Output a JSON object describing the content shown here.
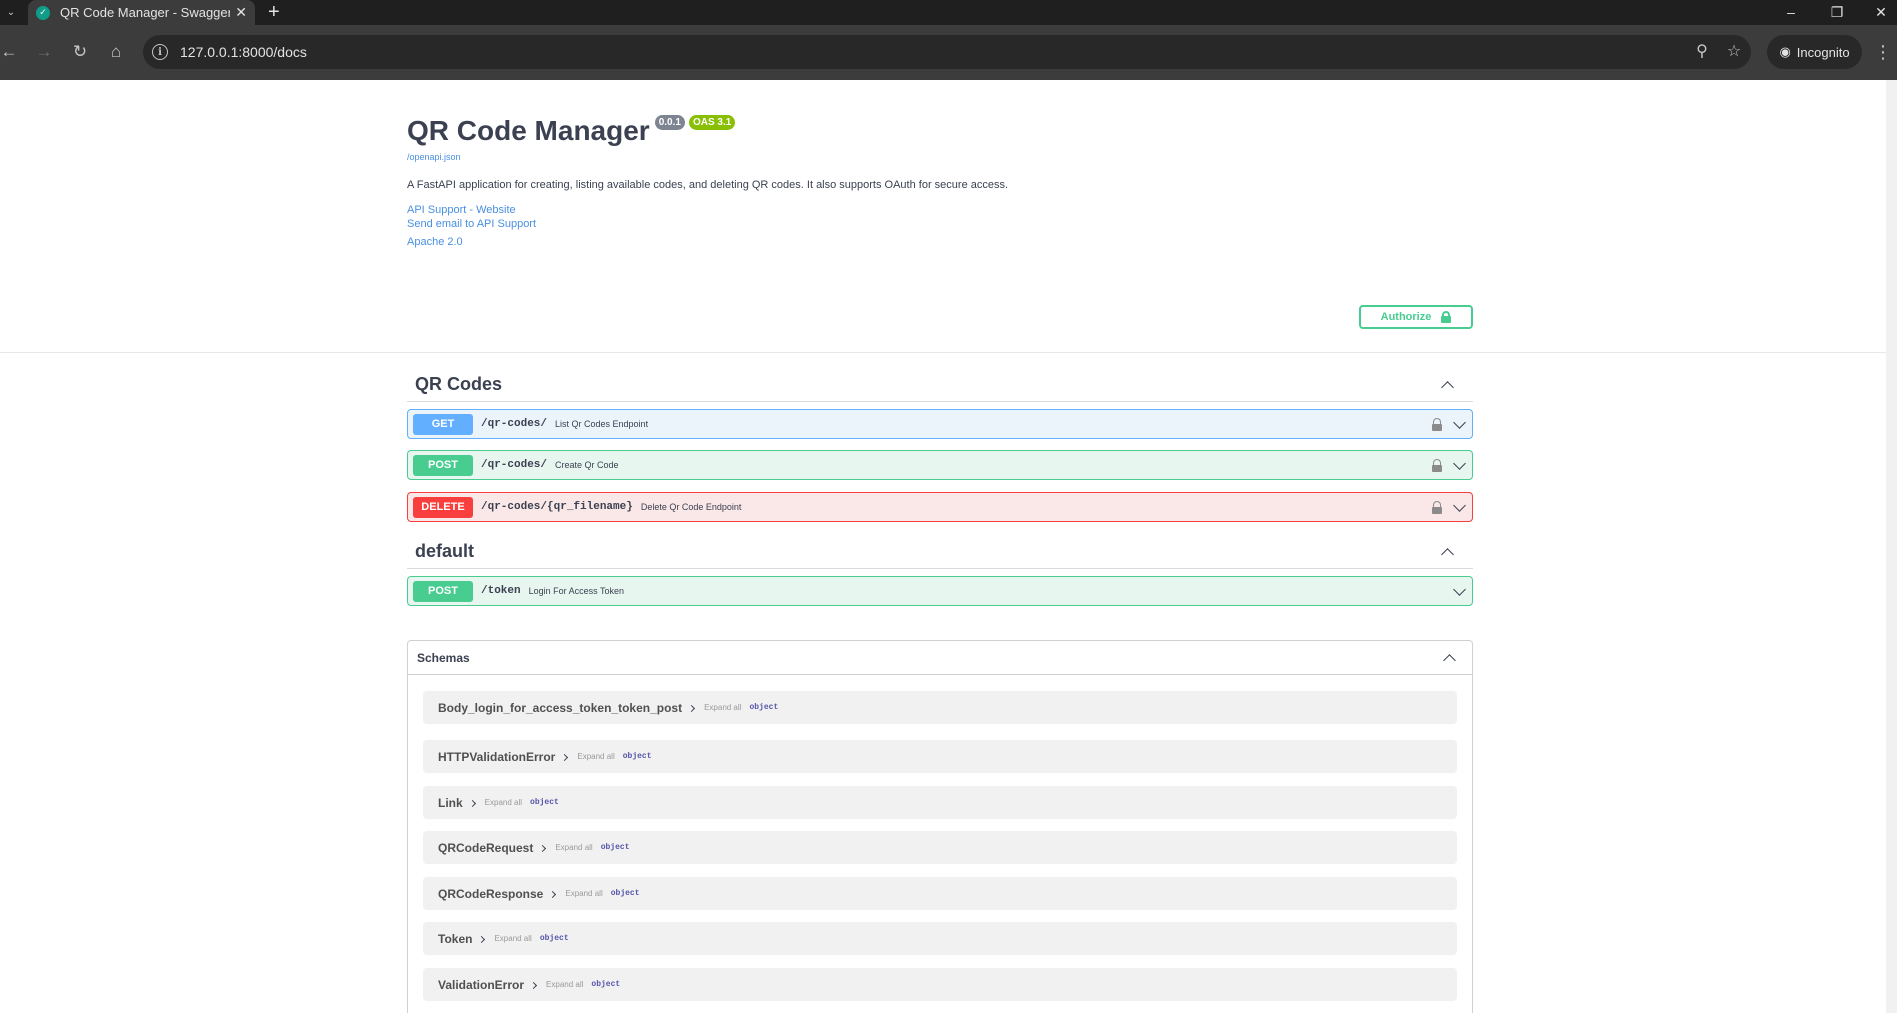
{
  "browser": {
    "tab_title": "QR Code Manager - Swagger UI",
    "url": "127.0.0.1:8000/docs",
    "profile_label": "Incognito"
  },
  "info": {
    "title": "QR Code Manager",
    "version": "0.0.1",
    "oas_version": "OAS 3.1",
    "openapi_link": "/openapi.json",
    "description": "A FastAPI application for creating, listing available codes, and deleting QR codes. It also supports OAuth for secure access.",
    "contact_website": "API Support - Website",
    "contact_email": "Send email to API Support",
    "license": "Apache 2.0"
  },
  "authorize_label": "Authorize",
  "sections": [
    {
      "title": "QR Codes",
      "operations": [
        {
          "method": "GET",
          "path": "/qr-codes/",
          "summary": "List Qr Codes Endpoint",
          "locked": true
        },
        {
          "method": "POST",
          "path": "/qr-codes/",
          "summary": "Create Qr Code",
          "locked": true
        },
        {
          "method": "DELETE",
          "path": "/qr-codes/{qr_filename}",
          "summary": "Delete Qr Code Endpoint",
          "locked": true
        }
      ]
    },
    {
      "title": "default",
      "operations": [
        {
          "method": "POST",
          "path": "/token",
          "summary": "Login For Access Token",
          "locked": false
        }
      ]
    }
  ],
  "schemas": {
    "title": "Schemas",
    "expand_label": "Expand all",
    "models": [
      {
        "name": "Body_login_for_access_token_token_post",
        "type": "object"
      },
      {
        "name": "HTTPValidationError",
        "type": "object"
      },
      {
        "name": "Link",
        "type": "object"
      },
      {
        "name": "QRCodeRequest",
        "type": "object"
      },
      {
        "name": "QRCodeResponse",
        "type": "object"
      },
      {
        "name": "Token",
        "type": "object"
      },
      {
        "name": "ValidationError",
        "type": "object"
      }
    ]
  },
  "colors": {
    "get": "#61affe",
    "post": "#49cc90",
    "delete": "#f93e3e",
    "link": "#4990e2"
  }
}
